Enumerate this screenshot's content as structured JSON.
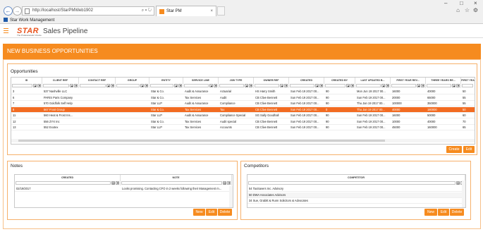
{
  "browser": {
    "url": "http://localhost/StarPMWeb1902",
    "tab_title": "Star PM",
    "favorites": [
      "Star Work Management"
    ],
    "address_tools": "⌕ ▾ ↻"
  },
  "app": {
    "logo": "STAR",
    "logo_sub": "The Professionals' Choice",
    "title": "Sales Pipeline"
  },
  "page_title": "NEW BUSINESS OPPORTUNITIES",
  "opportunities": {
    "title": "Opportunities",
    "columns": [
      "ID",
      "CLIENT REF",
      "CONTACT REF",
      "GROUP",
      "ENTITY",
      "SERVICE LINE",
      "JOB TYPE",
      "OWNER REF",
      "CREATED",
      "CREATED BY",
      "LAST UPDATED B...",
      "FIRST YEAR REV...",
      "THREE YEARS RE...",
      "FIRST YEA"
    ],
    "rows": [
      [
        "3",
        "537 Nashville LLC",
        "",
        "",
        "Star & Co.",
        "Audit & Assurance",
        "Actuarial",
        "HS Harry Smith",
        "Sun Feb 19 2017 00...",
        "90",
        "Mon Jun 19 2017 00...",
        "16000",
        "40000",
        "50"
      ],
      [
        "6",
        "PARIS Paris Company",
        "",
        "",
        "Star & Co.",
        "Tax Services",
        "Audit",
        "CB Clive Bennett",
        "Sun Feb 19 2017 00...",
        "90",
        "Sun Feb 19 2017 00...",
        "20000",
        "65000",
        "55"
      ],
      [
        "7",
        "570 Goldfolk Self Help",
        "",
        "",
        "Star LLP",
        "Audit & Assurance",
        "Compliance",
        "CB Clive Bennett",
        "Sun Feb 19 2017 00...",
        "90",
        "Thu Jan 19 2017 00...",
        "100000",
        "350000",
        "55"
      ],
      [
        "8",
        "567 Frost Group",
        "",
        "",
        "Star & Co.",
        "Tax Services",
        "Tax",
        "CB Clive Bennett",
        "Sun Feb 19 2017 00...",
        "0",
        "Thu Jan 19 2017 00...",
        "40000",
        "180000",
        "50"
      ],
      [
        "11",
        "560 Heat & Frost Ins...",
        "",
        "",
        "Star LLP",
        "Audit & Assurance",
        "Compliance Special",
        "SG Sally Goodhall",
        "Sun Feb 19 2017 00...",
        "90",
        "Sun Feb 19 2017 00...",
        "16000",
        "50000",
        "60"
      ],
      [
        "12",
        "556 ZYX Inc",
        "",
        "",
        "Star & Co.",
        "Tax Services",
        "Audit special",
        "CB Clive Bennett",
        "Sun Feb 19 2017 00...",
        "90",
        "Sun Feb 19 2017 00...",
        "10000",
        "40000",
        "70"
      ],
      [
        "13",
        "552 Exotex",
        "",
        "",
        "Star LLP",
        "Tax Services",
        "Accounts",
        "CB Clive Bennett",
        "Sun Feb 19 2017 00...",
        "90",
        "Sun Feb 19 2017 00...",
        "45000",
        "160000",
        "65"
      ]
    ],
    "selected_row": 3,
    "buttons": {
      "create": "Create",
      "edit": "Edit"
    }
  },
  "notes": {
    "title": "Notes",
    "columns": [
      "CREATED",
      "NOTE"
    ],
    "rows": [
      [
        "02/19/2017",
        "Looks promising. Contacting CFO in 2 weeks following their Management m..."
      ]
    ],
    "buttons": {
      "new": "New",
      "edit": "Edit",
      "delete": "Delete"
    }
  },
  "competitors": {
    "title": "Competitors",
    "columns": [
      "COMPETITOR"
    ],
    "rows": [
      [
        "54 TaxSavers Inc. Advisory"
      ],
      [
        "50 DWA Associates Advisors"
      ],
      [
        "34 Sue, Grabitt & Runn Solicitors & Advocates"
      ]
    ],
    "buttons": {
      "new": "New",
      "edit": "Edit",
      "delete": "Delete"
    }
  },
  "colors": {
    "accent": "#f68b1f",
    "selected": "#f26b21",
    "panel_border": "#f6b06b"
  }
}
